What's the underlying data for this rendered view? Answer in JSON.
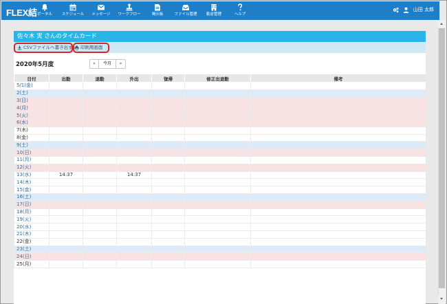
{
  "app": {
    "logo": "FLEX結"
  },
  "nav": [
    {
      "label": "ポータル",
      "icon": "bell-icon"
    },
    {
      "label": "スケジュール",
      "icon": "calendar-icon"
    },
    {
      "label": "メッセージ",
      "icon": "envelope-icon"
    },
    {
      "label": "ワークフロー",
      "icon": "stamp-icon"
    },
    {
      "label": "掲示板",
      "icon": "document-icon"
    },
    {
      "label": "ファイル管理",
      "icon": "inbox-icon"
    },
    {
      "label": "勤怠管理",
      "icon": "building-icon"
    },
    {
      "label": "ヘルプ",
      "icon": "question-icon"
    }
  ],
  "user": {
    "name": "山田 太郎"
  },
  "page": {
    "title": "佐々木 実 さんのタイムカード",
    "csv_label": "CSVファイルへ書き出す",
    "print_label": "印刷用画面",
    "year_label": "2020年5月度",
    "pager": {
      "prev": "«",
      "today": "今月",
      "next": "»"
    }
  },
  "table": {
    "headers": [
      "日付",
      "出勤",
      "退勤",
      "外出",
      "復帰",
      "修正出退勤",
      "備考"
    ],
    "rows": [
      {
        "date": "5/1(金)",
        "type": "weekday",
        "in": "",
        "out": "",
        "away": ""
      },
      {
        "date": "2(土)",
        "type": "sat",
        "in": "",
        "out": "",
        "away": ""
      },
      {
        "date": "3(日)",
        "type": "hol",
        "in": "",
        "out": "",
        "away": ""
      },
      {
        "date": "4(月)",
        "type": "hol",
        "in": "",
        "out": "",
        "away": ""
      },
      {
        "date": "5(火)",
        "type": "hol",
        "in": "",
        "out": "",
        "away": ""
      },
      {
        "date": "6(水)",
        "type": "hol",
        "in": "",
        "out": "",
        "away": ""
      },
      {
        "date": "7(木)",
        "type": "plain",
        "in": "",
        "out": "",
        "away": ""
      },
      {
        "date": "8(金)",
        "type": "plain",
        "in": "",
        "out": "",
        "away": ""
      },
      {
        "date": "9(土)",
        "type": "sat",
        "in": "",
        "out": "",
        "away": ""
      },
      {
        "date": "10(日)",
        "type": "hol",
        "in": "",
        "out": "",
        "away": ""
      },
      {
        "date": "11(月)",
        "type": "weekday",
        "in": "",
        "out": "",
        "away": ""
      },
      {
        "date": "12(火)",
        "type": "hol",
        "in": "",
        "out": "",
        "away": ""
      },
      {
        "date": "13(水)",
        "type": "weekday",
        "in": "14:37",
        "out": "",
        "away": "14:37"
      },
      {
        "date": "14(木)",
        "type": "weekday",
        "in": "",
        "out": "",
        "away": ""
      },
      {
        "date": "15(金)",
        "type": "weekday",
        "in": "",
        "out": "",
        "away": ""
      },
      {
        "date": "16(土)",
        "type": "sat",
        "in": "",
        "out": "",
        "away": ""
      },
      {
        "date": "17(日)",
        "type": "hol",
        "in": "",
        "out": "",
        "away": ""
      },
      {
        "date": "18(月)",
        "type": "weekday",
        "in": "",
        "out": "",
        "away": ""
      },
      {
        "date": "19(火)",
        "type": "weekday",
        "in": "",
        "out": "",
        "away": ""
      },
      {
        "date": "20(水)",
        "type": "weekday",
        "in": "",
        "out": "",
        "away": ""
      },
      {
        "date": "21(木)",
        "type": "weekday",
        "in": "",
        "out": "",
        "away": ""
      },
      {
        "date": "22(金)",
        "type": "plain",
        "in": "",
        "out": "",
        "away": ""
      },
      {
        "date": "23(土)",
        "type": "sat",
        "in": "",
        "out": "",
        "away": ""
      },
      {
        "date": "24(日)",
        "type": "hol",
        "in": "",
        "out": "",
        "away": ""
      },
      {
        "date": "25(月)",
        "type": "plain",
        "in": "",
        "out": "",
        "away": ""
      }
    ]
  },
  "colors": {
    "topbar": "#1e7fc8",
    "title_bar": "#29b5ea",
    "toolbar": "#cfe8f3",
    "saturday": "#dcebf7",
    "holiday": "#f9e2e4",
    "highlight": "#d9232a"
  }
}
